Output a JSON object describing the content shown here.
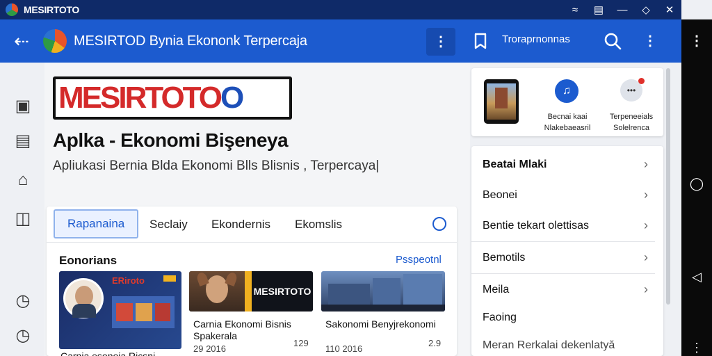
{
  "window": {
    "title": "MESIRTOTO"
  },
  "appbar": {
    "title": "MESIRTOD Bynia Ekononk Terpercaja",
    "chip_label": "Troraprnonnas"
  },
  "brand": {
    "logo_part1": "MESIR",
    "logo_part2": "TOTO",
    "logo_part3": "O"
  },
  "hero": {
    "headline": "Aplka - Ekonomi Bişeneya",
    "subheadline": "Apliukasi Bernia Blda Ekonomi Blls Blisnis , Terpercaya|"
  },
  "tabs": [
    {
      "label": "Rapanaina",
      "active": true
    },
    {
      "label": "Seclaiy"
    },
    {
      "label": "Ekondernis"
    },
    {
      "label": "Ekomslis"
    }
  ],
  "section": {
    "title": "Eonorians",
    "link": "Psspeotnl"
  },
  "cards": [
    {
      "badge": "ERiroto",
      "title": "Carnia esonoia Ricsni",
      "meta": "",
      "count": ""
    },
    {
      "banner": "MESIRTOTO",
      "title": "Carnia Ekonomi Bisnis Spakerala",
      "meta": "29 2016",
      "count": "129"
    },
    {
      "title": "Sakonomi Benyjrekonomi",
      "meta": "110 2016",
      "count": "2.9"
    }
  ],
  "quick_actions": [
    {
      "label": ""
    },
    {
      "label": "Becnai kaai\nNlakebaeasril"
    },
    {
      "label": "Terpeneeials\nSolelrenca"
    }
  ],
  "menu": [
    {
      "label": "Beatai Mlaki"
    },
    {
      "label": "Beonei"
    },
    {
      "label": "Bentie tekart olettisas"
    },
    {
      "label": "Bemotils"
    },
    {
      "label": "Meila"
    },
    {
      "label": "Faoing"
    },
    {
      "label": "Meran Rerkalai dekenlatyă"
    }
  ],
  "colors": {
    "accent": "#1c5bcf",
    "titlebar": "#0f2a68",
    "logo_red": "#d42a2a"
  }
}
